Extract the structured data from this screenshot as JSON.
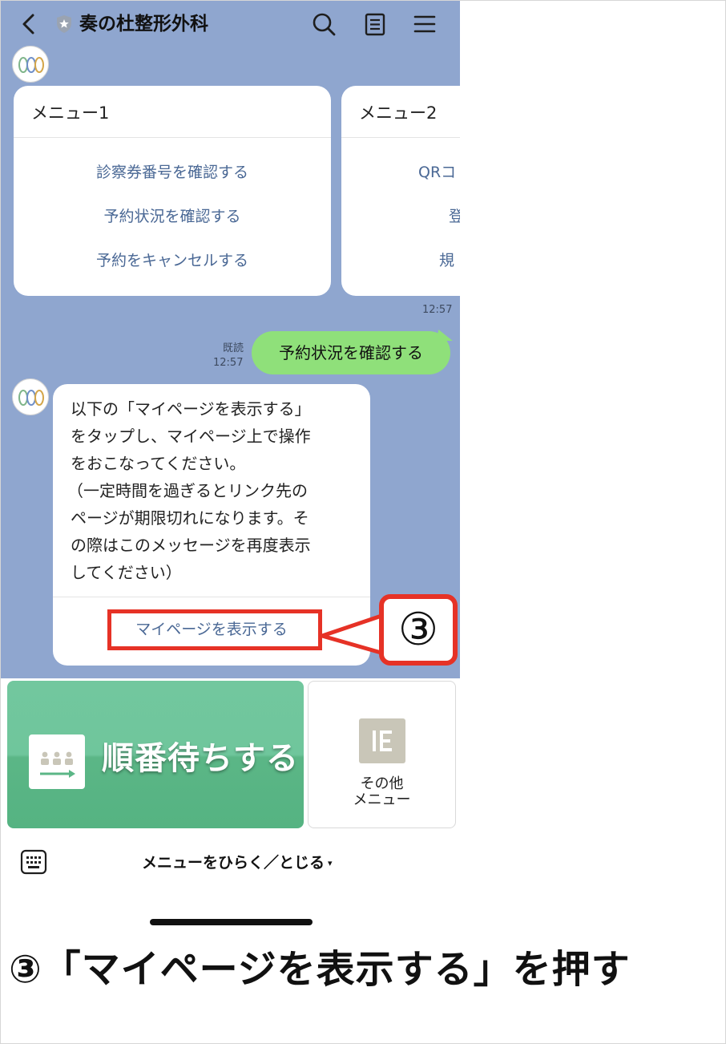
{
  "header": {
    "title": "奏の杜整形外科",
    "back_icon": "chevron-left-icon",
    "search_icon": "search-icon",
    "notes_icon": "notes-icon",
    "menu_icon": "hamburger-menu-icon"
  },
  "carousel": [
    {
      "title": "メニュー1",
      "items": [
        "診察券番号を確認する",
        "予約状況を確認する",
        "予約をキャンセルする"
      ]
    },
    {
      "title": "メニュー2",
      "items": [
        "QRコ",
        "登",
        "規"
      ]
    }
  ],
  "carousel_time": "12:57",
  "user_message": {
    "read_label": "既読",
    "time": "12:57",
    "text": "予約状況を確認する"
  },
  "bot_reply": {
    "lines": [
      "以下の「マイページを表示する」",
      "をタップし、マイページ上で操作",
      "をおこなってください。",
      "（一定時間を過ぎるとリンク先の",
      "ページが期限切れになります。そ",
      "の際はこのメッセージを再度表示",
      "してください）"
    ],
    "link_label": "マイページを表示する"
  },
  "annotation": {
    "callout_number": "③",
    "color": "#e63226"
  },
  "rich_menu": {
    "wait_label": "順番待ちする",
    "other_label_line1": "その他",
    "other_label_line2": "メニュー",
    "accent": "#5bb686"
  },
  "bottom_bar": {
    "keyboard_icon": "keyboard-icon",
    "menu_toggle_label": "メニューをひらく／とじる",
    "caret": "▾"
  },
  "caption": "③「マイページを表示する」を押す"
}
